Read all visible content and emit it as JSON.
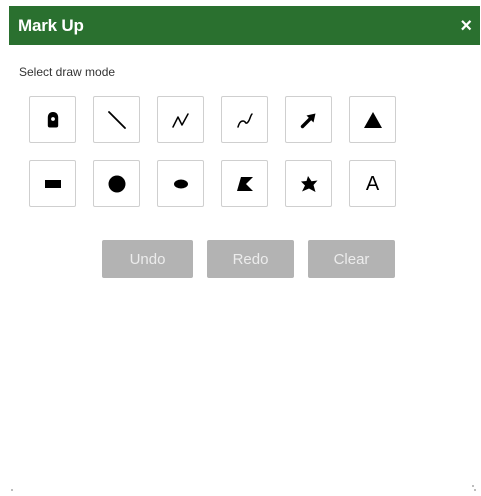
{
  "panel": {
    "title": "Mark Up",
    "close_glyph": "×",
    "header_color": "#2a702f"
  },
  "draw_mode": {
    "label": "Select draw mode",
    "tools": [
      {
        "name": "point",
        "icon": "map-pin-icon"
      },
      {
        "name": "line",
        "icon": "line-icon"
      },
      {
        "name": "polyline",
        "icon": "polyline-icon"
      },
      {
        "name": "freehand-polyline",
        "icon": "freehand-line-icon"
      },
      {
        "name": "arrow",
        "icon": "arrow-icon"
      },
      {
        "name": "triangle",
        "icon": "triangle-icon"
      },
      {
        "name": "rectangle",
        "icon": "rectangle-icon"
      },
      {
        "name": "circle",
        "icon": "circle-icon"
      },
      {
        "name": "ellipse",
        "icon": "ellipse-icon"
      },
      {
        "name": "polygon",
        "icon": "polygon-icon"
      },
      {
        "name": "freehand-polygon",
        "icon": "freehand-polygon-icon"
      },
      {
        "name": "text",
        "icon": "text-icon",
        "glyph": "A"
      }
    ]
  },
  "actions": {
    "undo_label": "Undo",
    "redo_label": "Redo",
    "clear_label": "Clear",
    "disabled_color": "#b3b3b3"
  }
}
